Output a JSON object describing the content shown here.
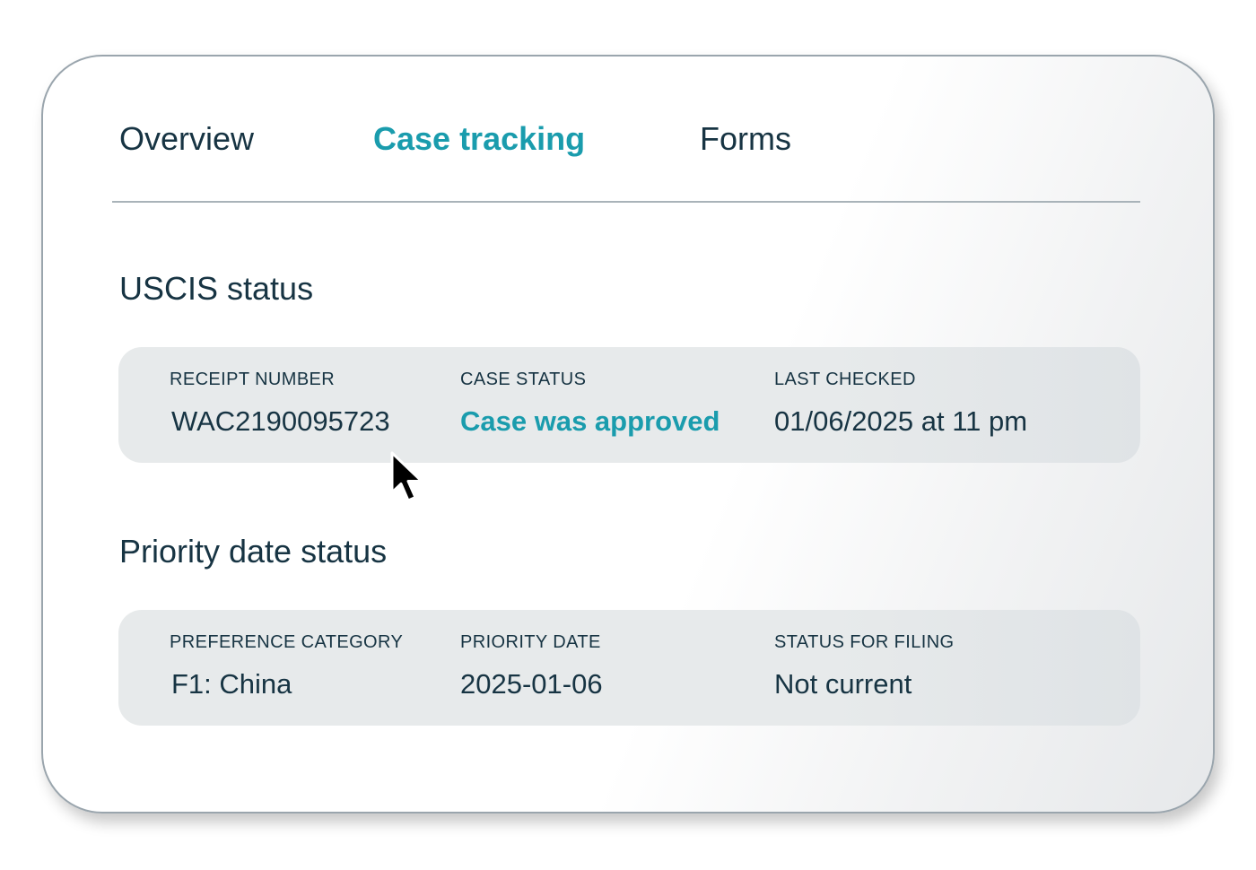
{
  "tabs": [
    {
      "label": "Overview",
      "active": false
    },
    {
      "label": "Case tracking",
      "active": true
    },
    {
      "label": "Forms",
      "active": false
    }
  ],
  "uscis": {
    "title": "USCIS status",
    "receipt_number": {
      "label": "RECEIPT NUMBER",
      "value": "WAC2190095723"
    },
    "case_status": {
      "label": "CASE STATUS",
      "value": "Case was approved"
    },
    "last_checked": {
      "label": "LAST CHECKED",
      "value": "01/06/2025 at 11 pm"
    }
  },
  "priority": {
    "title": "Priority date status",
    "preference_category": {
      "label": "PREFERENCE CATEGORY",
      "value": "F1: China"
    },
    "priority_date": {
      "label": "PRIORITY DATE",
      "value": "2025-01-06"
    },
    "status_for_filing": {
      "label": "STATUS FOR FILING",
      "value": "Not current"
    }
  },
  "colors": {
    "accent": "#1a9cad",
    "text": "#173443",
    "panel": "#e7eaeb"
  },
  "icons": {
    "cursor": "mouse-pointer-icon"
  }
}
